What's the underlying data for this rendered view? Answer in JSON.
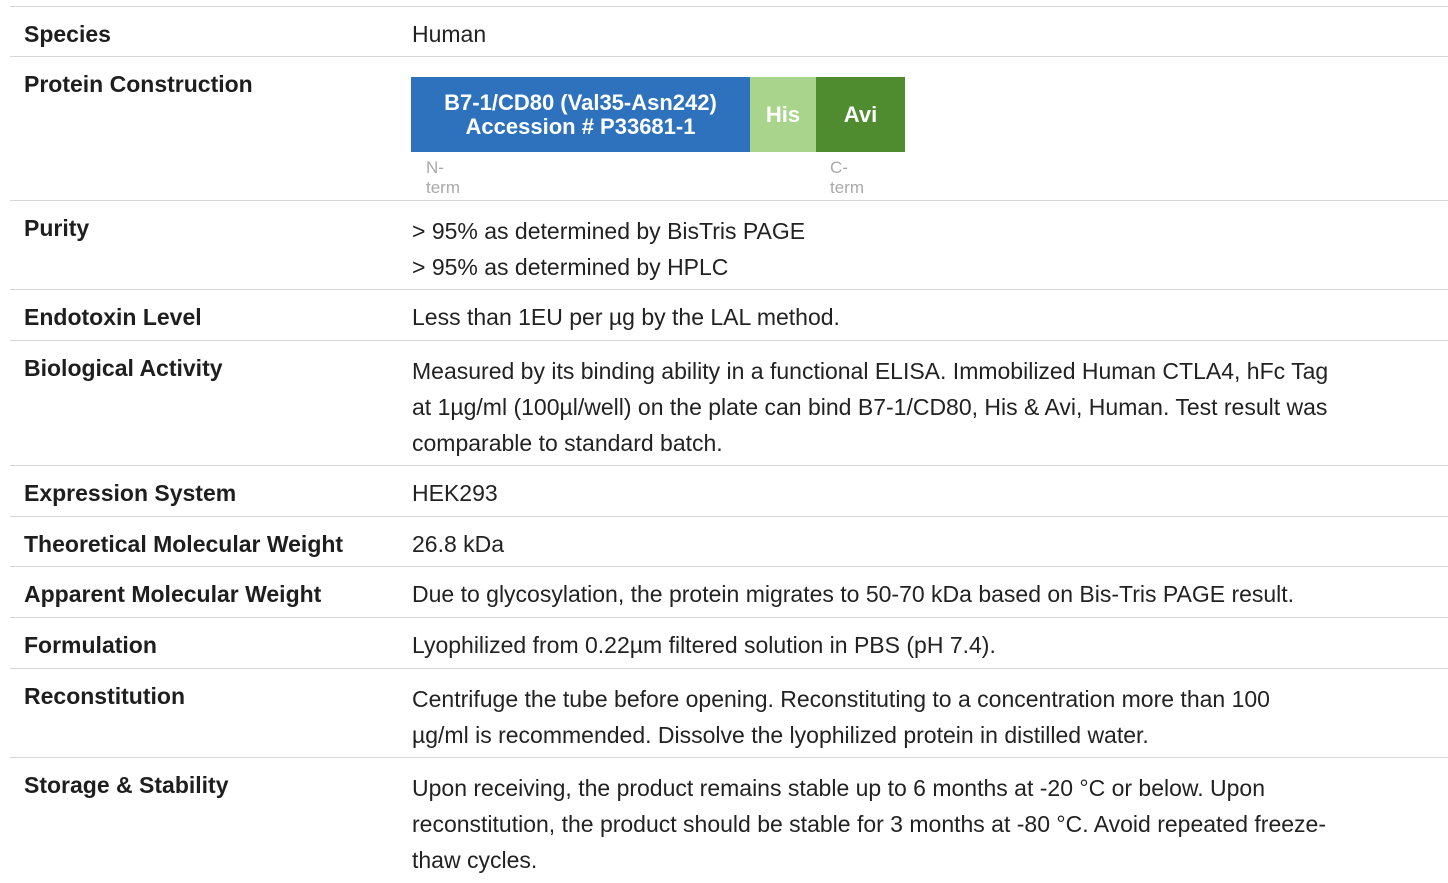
{
  "rows": [
    {
      "label": "Species",
      "value": [
        "Human"
      ]
    },
    {
      "label": "Protein Construction",
      "value": []
    },
    {
      "label": "Purity",
      "value": [
        "> 95% as determined by BisTris PAGE",
        "> 95% as determined by HPLC"
      ]
    },
    {
      "label": "Endotoxin Level",
      "value": [
        "Less than 1EU per µg by the LAL method."
      ]
    },
    {
      "label": "Biological Activity",
      "value": [
        "Measured by its binding ability in a functional ELISA. Immobilized Human CTLA4, hFc Tag",
        "at 1µg/ml (100µl/well) on the plate can bind B7-1/CD80, His & Avi, Human. Test result was",
        "comparable to standard batch."
      ]
    },
    {
      "label": "Expression System",
      "value": [
        "HEK293"
      ]
    },
    {
      "label": "Theoretical Molecular Weight",
      "value": [
        "26.8 kDa"
      ]
    },
    {
      "label": "Apparent Molecular Weight",
      "value": [
        "Due to glycosylation, the protein migrates to 50-70 kDa based on Bis-Tris PAGE result."
      ]
    },
    {
      "label": "Formulation",
      "value": [
        "Lyophilized from 0.22µm filtered solution in PBS (pH 7.4)."
      ]
    },
    {
      "label": "Reconstitution",
      "value": [
        "Centrifuge the tube before opening. Reconstituting to a concentration more than 100",
        "µg/ml is recommended. Dissolve the lyophilized protein in distilled water."
      ]
    },
    {
      "label": "Storage & Stability",
      "value": [
        "Upon receiving, the product remains stable up to 6 months at -20 °C or below. Upon",
        "reconstitution, the product should be stable for 3 months at -80 °C. Avoid repeated freeze-",
        "thaw cycles."
      ]
    }
  ],
  "construct": {
    "main_line1": "B7-1/CD80 (Val35-Asn242)",
    "main_line2": "Accession # P33681-1",
    "his_label": "His",
    "avi_label": "Avi",
    "n_term": "N-term",
    "c_term": "C-term",
    "colors": {
      "main": "#2e72bd",
      "his": "#a8d48c",
      "avi": "#4f8b2f"
    }
  }
}
